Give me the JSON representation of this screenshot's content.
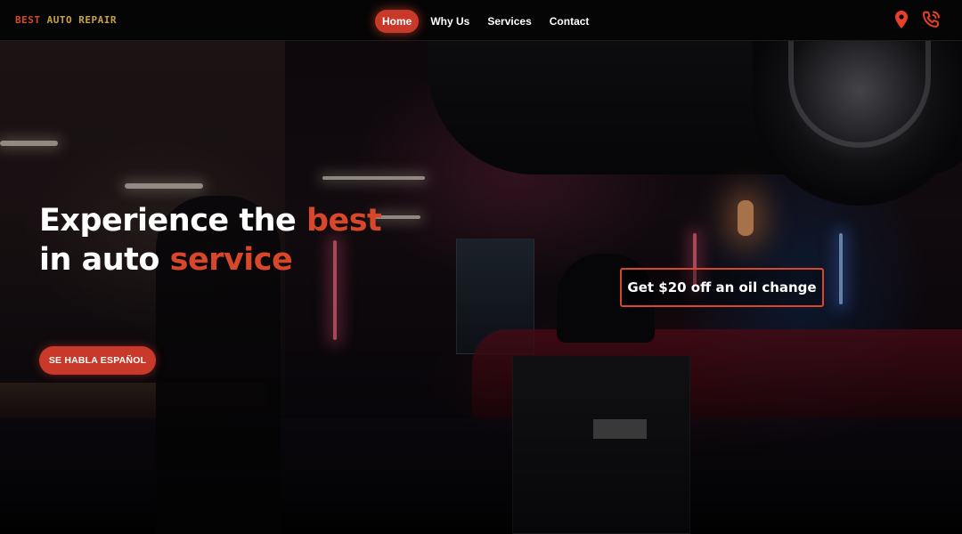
{
  "brand": {
    "logo_word1": "BEST",
    "logo_word2": "AUTO REPAIR"
  },
  "nav": {
    "links": [
      {
        "label": "Home",
        "active": true
      },
      {
        "label": "Why Us",
        "active": false
      },
      {
        "label": "Services",
        "active": false
      },
      {
        "label": "Contact",
        "active": false
      }
    ],
    "icons": [
      "map-pin-icon",
      "phone-ringing-icon"
    ]
  },
  "hero": {
    "line1_text": "Experience the",
    "line1_accent": "best",
    "line2_text": "in auto",
    "line2_accent": "service",
    "cta_label": "SE HABLA ESPAÑOL",
    "promo_label": "Get $20 off an oil change"
  },
  "colors": {
    "accent": "#d9472a",
    "button": "#c8392a",
    "logo_secondary": "#c9a14a",
    "navbar": "#050505"
  }
}
